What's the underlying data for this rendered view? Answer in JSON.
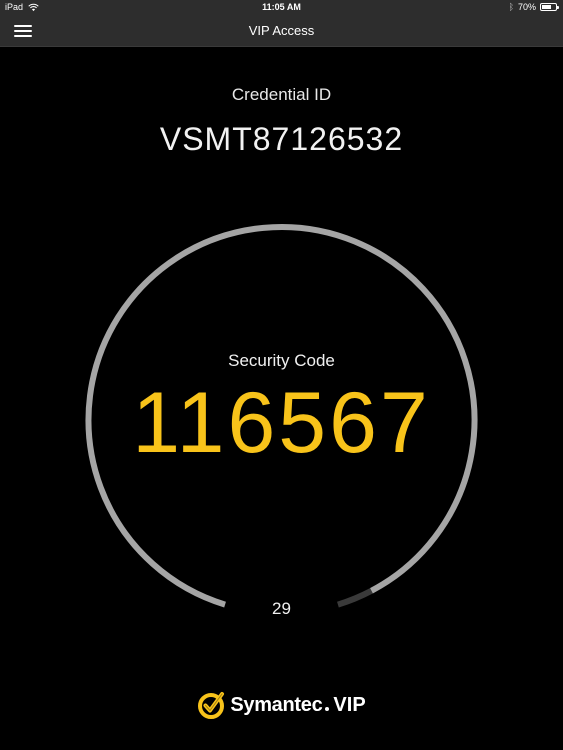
{
  "status_bar": {
    "device": "iPad",
    "time": "11:05 AM",
    "battery_text": "70%",
    "battery_level": 0.7,
    "icons": [
      "wifi-icon",
      "bluetooth-icon",
      "battery-icon"
    ]
  },
  "nav": {
    "title": "VIP Access",
    "menu_icon": "hamburger-menu-icon"
  },
  "credential": {
    "label": "Credential ID",
    "value": "VSMT87126532"
  },
  "security": {
    "label": "Security Code",
    "code": "116567",
    "seconds_remaining": "29",
    "timer_fraction_remaining": 0.967
  },
  "brand": {
    "name": "Symantec",
    "product": "VIP",
    "logo_icon": "symantec-check-logo-icon"
  },
  "colors": {
    "background": "#000000",
    "bar": "#2d2d2d",
    "code": "#f8c31a",
    "ring": "#a5a5a5",
    "ring_elapsed": "#3a3a3a"
  }
}
